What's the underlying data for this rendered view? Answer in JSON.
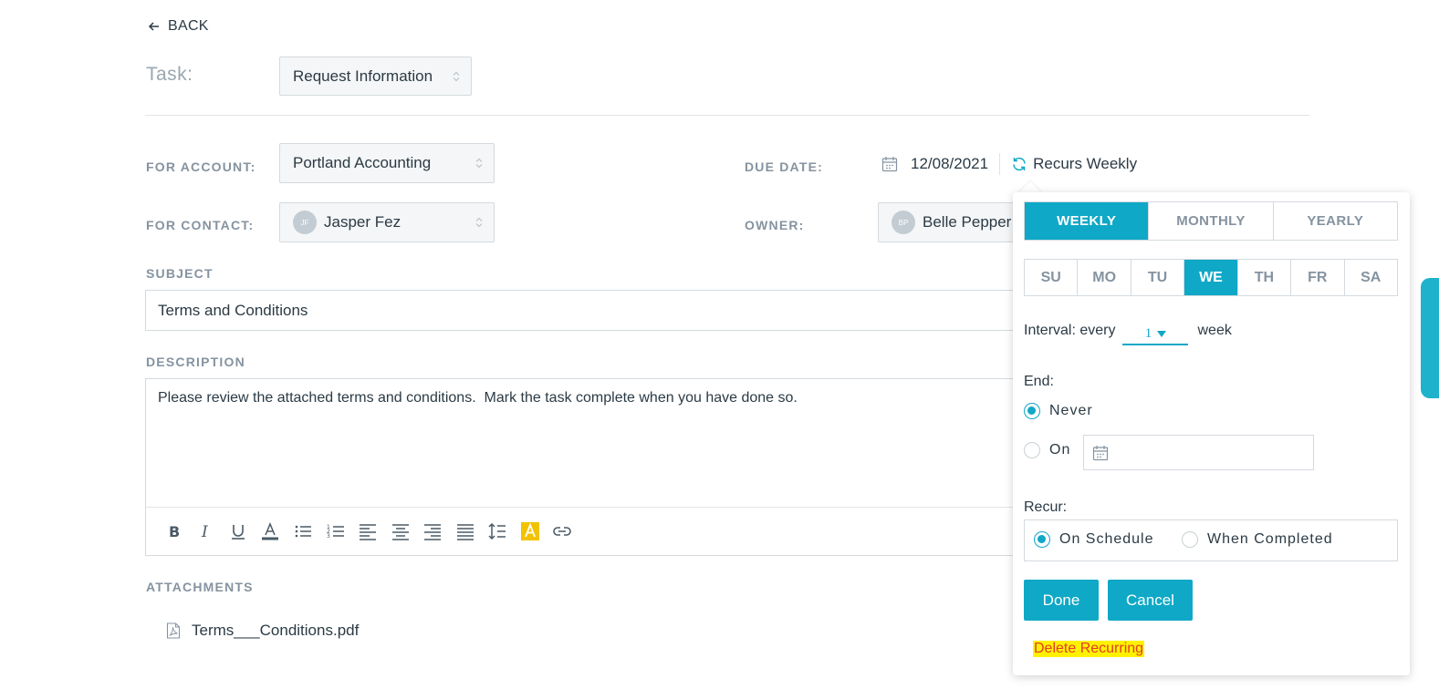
{
  "back": {
    "label": "BACK",
    "icon": "arrow-left-icon"
  },
  "task": {
    "label": "Task:",
    "value": "Request Information"
  },
  "form": {
    "account_label": "FOR ACCOUNT:",
    "account_value": "Portland Accounting",
    "contact_label": "FOR CONTACT:",
    "contact_value": "Jasper Fez",
    "contact_initials": "JF",
    "due_label": "DUE DATE:",
    "due_value": "12/08/2021",
    "recurs_label": "Recurs Weekly",
    "owner_label": "OWNER:",
    "owner_value": "Belle Pepper",
    "owner_initials": "BP",
    "subject_label": "SUBJECT",
    "subject_value": "Terms and Conditions",
    "description_label": "DESCRIPTION",
    "description_value": "Please review the attached terms and conditions.  Mark the task complete when you have done so.",
    "attachments_label": "ATTACHMENTS",
    "attachments": [
      "Terms___Conditions.pdf"
    ]
  },
  "toolbar": {
    "buttons": [
      "bold-icon",
      "italic-icon",
      "underline-icon",
      "font-color-icon",
      "bullet-list-icon",
      "numbered-list-icon",
      "align-left-icon",
      "align-center-icon",
      "align-right-icon",
      "justify-icon",
      "line-height-icon",
      "highlight-icon",
      "link-icon"
    ]
  },
  "recurrence": {
    "frequency_tabs": [
      "WEEKLY",
      "MONTHLY",
      "YEARLY"
    ],
    "active_frequency": "WEEKLY",
    "days": [
      "SU",
      "MO",
      "TU",
      "WE",
      "TH",
      "FR",
      "SA"
    ],
    "active_day": "WE",
    "interval_prefix": "Interval: every",
    "interval_value": "1",
    "interval_suffix": "week",
    "end_label": "End:",
    "end_never": "Never",
    "end_on": "On",
    "end_selected": "Never",
    "recur_label": "Recur:",
    "recur_on_schedule": "On Schedule",
    "recur_when_completed": "When Completed",
    "recur_selected": "On Schedule",
    "done_label": "Done",
    "cancel_label": "Cancel",
    "delete_label": "Delete Recurring"
  },
  "colors": {
    "accent": "#0fa8c7",
    "label": "#8593a0",
    "text": "#2b3a44",
    "delete_text": "#e23d2a",
    "delete_highlight": "#fff200",
    "highlight_icon": "#f2c200"
  }
}
